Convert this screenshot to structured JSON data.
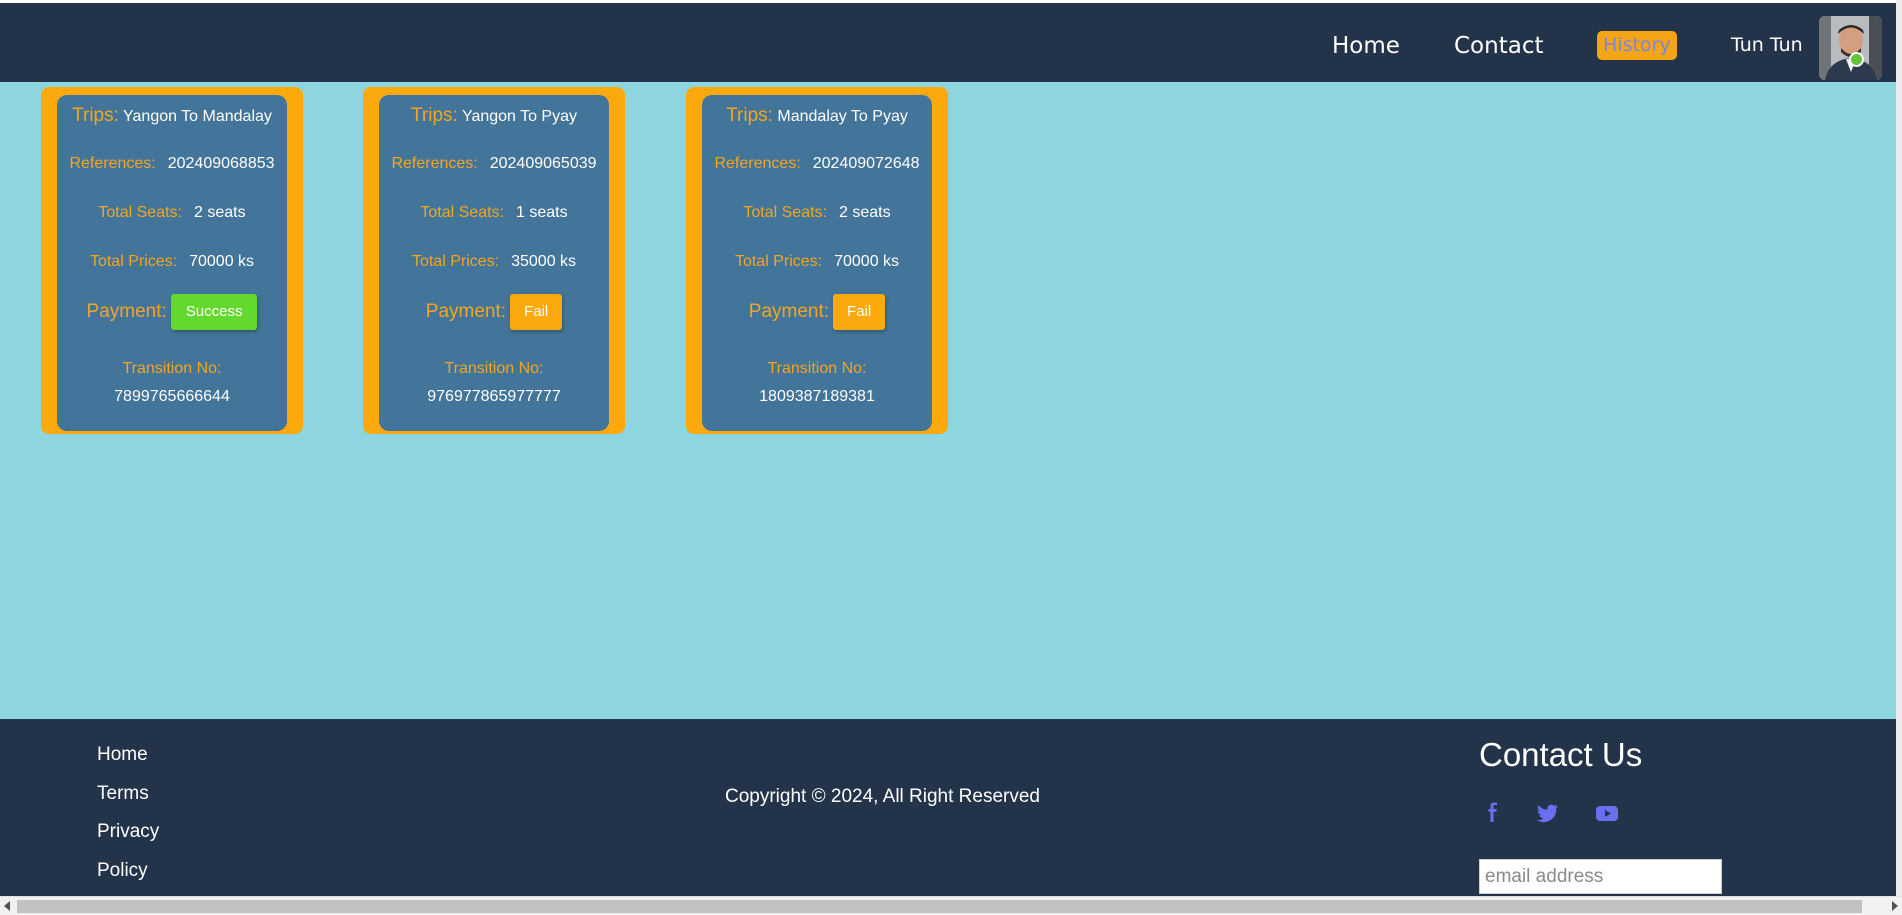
{
  "header": {
    "nav": {
      "home": "Home",
      "contact": "Contact",
      "history": "History"
    },
    "user_name": "Tun Tun"
  },
  "labels": {
    "trips": "Trips:",
    "references": "References:",
    "total_seats": "Total Seats:",
    "total_prices": "Total Prices:",
    "payment": "Payment:",
    "transition_no": "Transition No:"
  },
  "bookings": [
    {
      "trip": "Yangon To Mandalay",
      "reference": "202409068853",
      "seats": "2 seats",
      "price": "70000 ks",
      "payment": "Success",
      "transition_no": "7899765666644"
    },
    {
      "trip": "Yangon To Pyay",
      "reference": "202409065039",
      "seats": "1 seats",
      "price": "35000 ks",
      "payment": "Fail",
      "transition_no": "976977865977777"
    },
    {
      "trip": "Mandalay To Pyay",
      "reference": "202409072648",
      "seats": "2 seats",
      "price": "70000 ks",
      "payment": "Fail",
      "transition_no": "1809387189381"
    }
  ],
  "footer": {
    "links": {
      "home": "Home",
      "terms": "Terms",
      "privacy": "Privacy",
      "policy": "Policy"
    },
    "copyright": "Copyright © 2024, All Right Reserved",
    "contact_title": "Contact Us",
    "email_placeholder": "email address",
    "social_icons": [
      "facebook-icon",
      "twitter-icon",
      "youtube-icon"
    ]
  },
  "colors": {
    "header_bg": "#233349",
    "main_bg": "#8dd5df",
    "card_border": "#fca90d",
    "card_bg": "#437499",
    "label": "#f4a61f",
    "success": "#63d82f",
    "fail": "#fca90d",
    "social": "#6a6ff0"
  }
}
